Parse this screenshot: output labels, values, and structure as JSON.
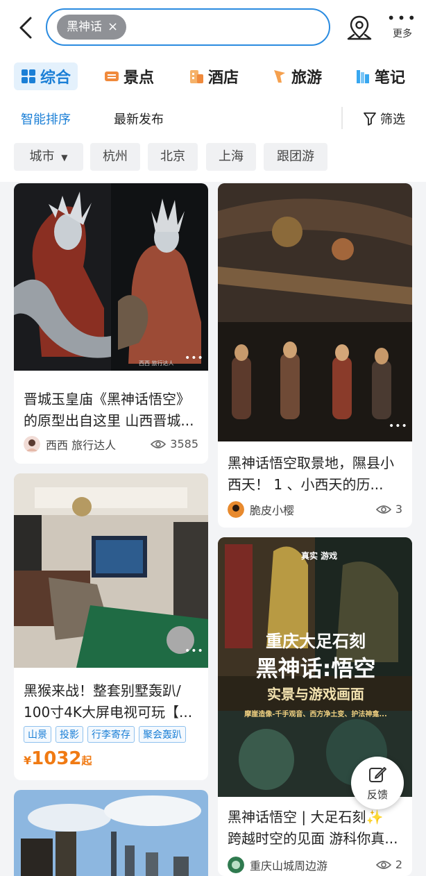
{
  "header": {
    "search_chip": "黑神话",
    "more_label": "更多"
  },
  "tabs": [
    {
      "label": "综合",
      "icon": "grid-icon",
      "active": true
    },
    {
      "label": "景点",
      "icon": "ticket-icon"
    },
    {
      "label": "酒店",
      "icon": "hotel-icon"
    },
    {
      "label": "旅游",
      "icon": "flag-icon"
    },
    {
      "label": "笔记",
      "icon": "notebook-icon"
    }
  ],
  "sort": {
    "smart": "智能排序",
    "latest": "最新发布",
    "filter": "筛选"
  },
  "filter_chips": [
    "城市",
    "杭州",
    "北京",
    "上海",
    "跟团游"
  ],
  "cards": {
    "c1": {
      "title_line1": "晋城玉皇庙《黑神话悟空》",
      "title_line2": "的原型出自这里 山西晋城...",
      "author": "西西 旅行达人",
      "views": "3585",
      "img_caption": "西西 旅行达人"
    },
    "c2": {
      "title_line1": "黑神话悟空取景地，隰县小",
      "title_line2": "西天！ 1 、小西天的历...",
      "author": "脆皮小樱",
      "views": "3"
    },
    "c3": {
      "title_line1": "黑猴来战！整套别墅轰趴/",
      "title_line2": "100寸4K大屏电视可玩【...",
      "tags": [
        "山景",
        "投影",
        "行李寄存",
        "聚会轰趴"
      ],
      "price_currency": "¥",
      "price_value": "1032",
      "price_unit": "起"
    },
    "c4": {
      "poster_small": "真实 游戏",
      "poster_line1": "重庆大足石刻",
      "poster_line2": "黑神话:悟空",
      "poster_line3": "实景与游戏画面",
      "poster_sub": "摩崖造像-千手观音、西方净土变、护法神龛...",
      "title_line1": "黑神话悟空 | 大足石刻✨",
      "title_line2": "跨越时空的见面 游科你真...",
      "author": "重庆山城周边游",
      "views": "2"
    }
  },
  "feedback": "反馈",
  "colors": {
    "accent": "#1b7fd6",
    "price": "#f07a13"
  }
}
